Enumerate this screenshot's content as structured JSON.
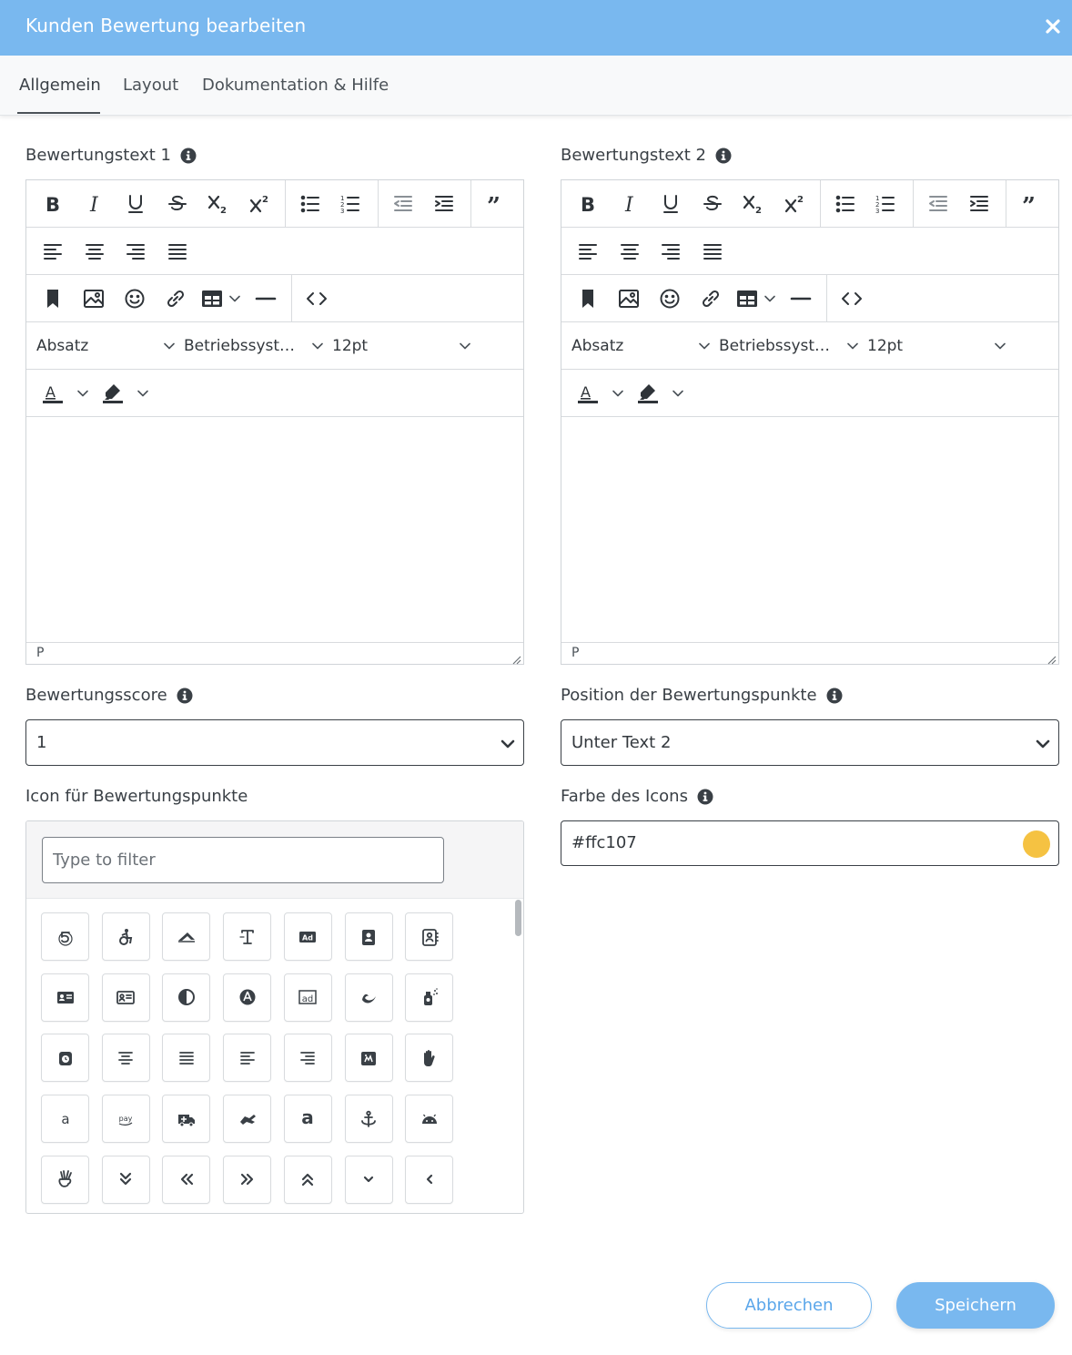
{
  "dialog": {
    "title": "Kunden Bewertung bearbeiten",
    "accent_color": "#79b8ef"
  },
  "tabs": [
    {
      "label": "Allgemein",
      "active": true
    },
    {
      "label": "Layout",
      "active": false
    },
    {
      "label": "Dokumentation & Hilfe",
      "active": false
    }
  ],
  "editor1": {
    "label": "Bewertungstext 1",
    "block_format": "Absatz",
    "font_family": "Betriebssyst…",
    "font_size": "12pt",
    "status_path": "P"
  },
  "editor2": {
    "label": "Bewertungstext 2",
    "block_format": "Absatz",
    "font_family": "Betriebssyst…",
    "font_size": "12pt",
    "status_path": "P"
  },
  "toolbar_icons": [
    "bold-icon",
    "italic-icon",
    "underline-icon",
    "strikethrough-icon",
    "subscript-icon",
    "superscript-icon",
    "bullet-list-icon",
    "numbered-list-icon",
    "outdent-icon",
    "indent-icon",
    "blockquote-icon",
    "align-left-icon",
    "align-center-icon",
    "align-right-icon",
    "align-justify-icon",
    "bookmark-icon",
    "image-icon",
    "emoji-icon",
    "link-icon",
    "table-icon",
    "horizontal-rule-icon",
    "source-code-icon",
    "text-color-icon",
    "highlight-color-icon"
  ],
  "score": {
    "label": "Bewertungsscore",
    "value": "1"
  },
  "position": {
    "label": "Position der Bewertungspunkte",
    "value": "Unter Text 2"
  },
  "icon_picker": {
    "label": "Icon für Bewertungspunkte",
    "filter_placeholder": "Type to filter",
    "icons": [
      "500px-icon",
      "accessible-icon",
      "accusoft-icon",
      "text-height-icon",
      "ad-badge-icon",
      "address-book-icon",
      "address-book-outline-icon",
      "address-card-icon",
      "address-card-outline-icon",
      "adjust-icon",
      "app-store-circle-icon",
      "ad-outline-icon",
      "moon-swoosh-icon",
      "spray-bottle-icon",
      "alarm-clock-icon",
      "align-center-icon",
      "align-justify-icon",
      "align-left-icon",
      "align-right-icon",
      "allergies-card-icon",
      "allergies-hand-icon",
      "amazon-icon",
      "amazon-pay-icon",
      "ambulance-icon",
      "american-sign-language-icon",
      "amazon-bold-icon",
      "anchor-icon",
      "android-icon",
      "angellist-icon",
      "angle-double-down-icon",
      "angle-double-left-icon",
      "angle-double-right-icon",
      "angle-double-up-icon",
      "angle-down-icon",
      "angle-left-icon"
    ]
  },
  "icon_color": {
    "label": "Farbe des Icons",
    "value": "#ffc107",
    "swatch_color": "#f5c242"
  },
  "actions": {
    "cancel_label": "Abbrechen",
    "save_label": "Speichern"
  }
}
